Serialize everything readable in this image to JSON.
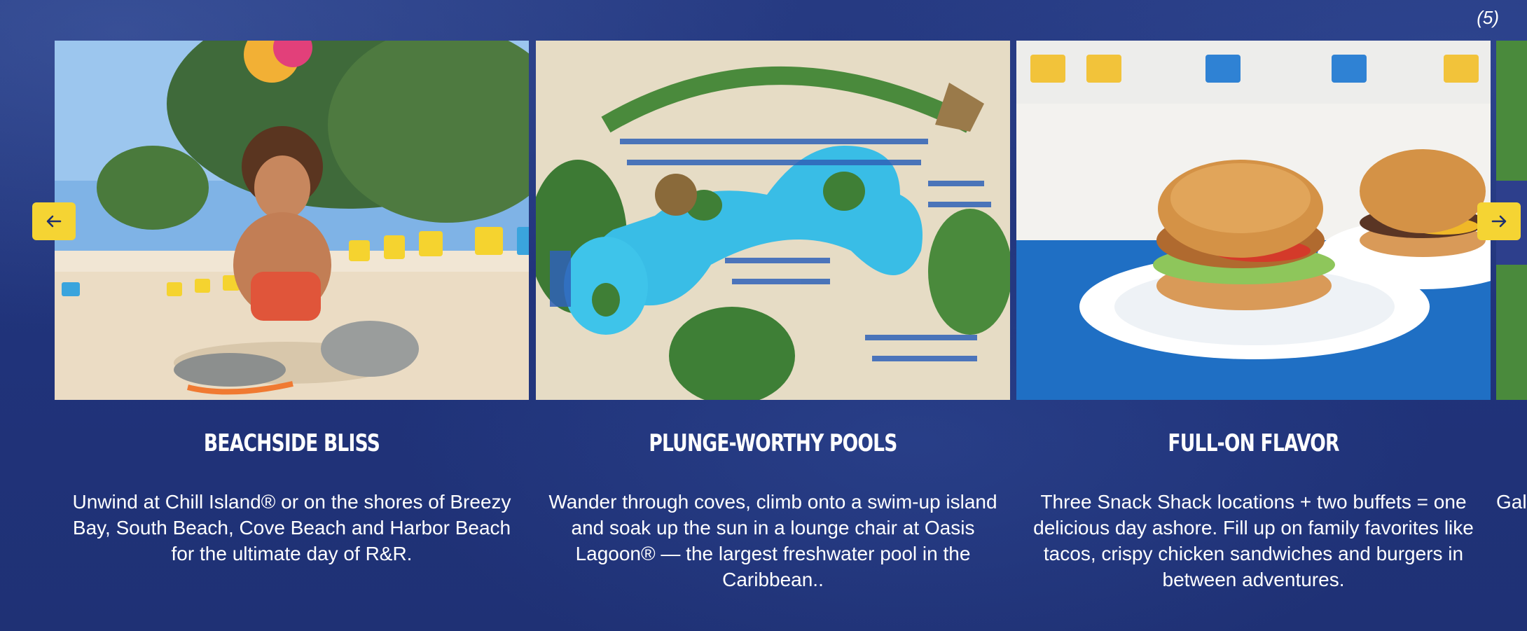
{
  "carousel": {
    "count_label": "(5)",
    "prev_label": "←",
    "next_label": "→",
    "cards": [
      {
        "title": "BEACHSIDE BLISS",
        "text": "Unwind at Chill Island® or on the shores of Breezy Bay, South Beach, Cove Beach and Harbor Beach for the ultimate day of R&R.",
        "image": "child-on-beach-photo"
      },
      {
        "title": "PLUNGE-WORTHY POOLS",
        "text": "Wander through coves, climb onto a swim-up island and soak up the sun in a lounge chair at Oasis Lagoon® — the largest freshwater pool in the Caribbean..",
        "image": "aerial-pool-photo"
      },
      {
        "title": "FULL-ON FLAVOR",
        "text": "Three Snack Shack locations + two buffets = one delicious day ashore. Fill up on family favorites like tacos, crispy chicken sandwiches and burgers in between adventures.",
        "image": "burgers-photo"
      },
      {
        "text": "Gal",
        "image": "partial-photo"
      }
    ]
  },
  "colors": {
    "background": "#22347a",
    "nav_button": "#f5d433",
    "text": "#ffffff"
  }
}
